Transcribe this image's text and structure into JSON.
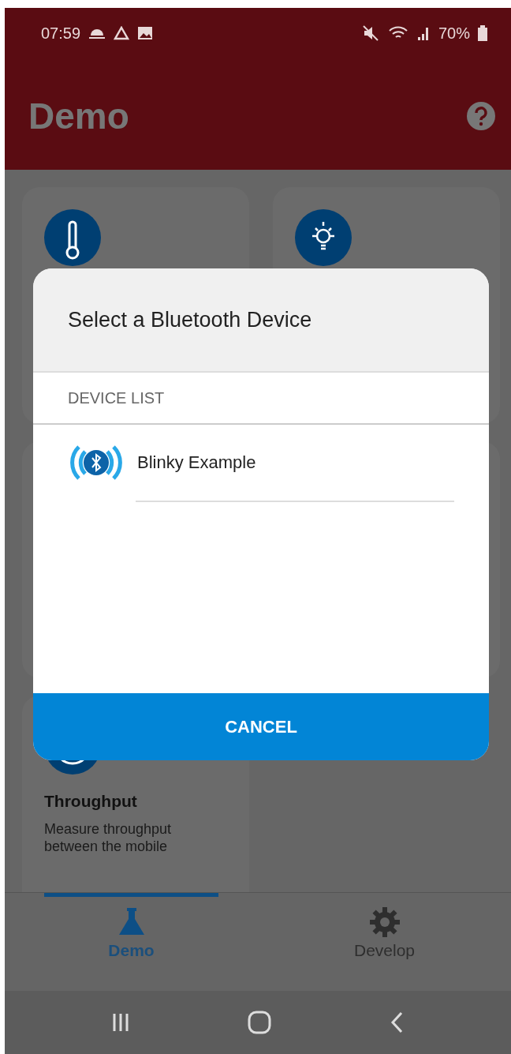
{
  "status_bar": {
    "time": "07:59",
    "battery": "70%"
  },
  "app_bar": {
    "title": "Demo"
  },
  "cards": [
    {
      "kind": "thermometer"
    },
    {
      "kind": "bulb"
    },
    {
      "kind": "blank"
    },
    {
      "kind": "blank"
    },
    {
      "kind": "gauge",
      "title": "Throughput",
      "description": "Measure throughput between the mobile"
    }
  ],
  "dialog": {
    "title": "Select a Bluetooth Device",
    "section": "DEVICE LIST",
    "devices": [
      {
        "name": "Blinky Example"
      }
    ],
    "cancel": "CANCEL"
  },
  "tabs": [
    {
      "label": "Demo",
      "kind": "flask",
      "selected": true
    },
    {
      "label": "Develop",
      "kind": "gear",
      "selected": false
    }
  ]
}
